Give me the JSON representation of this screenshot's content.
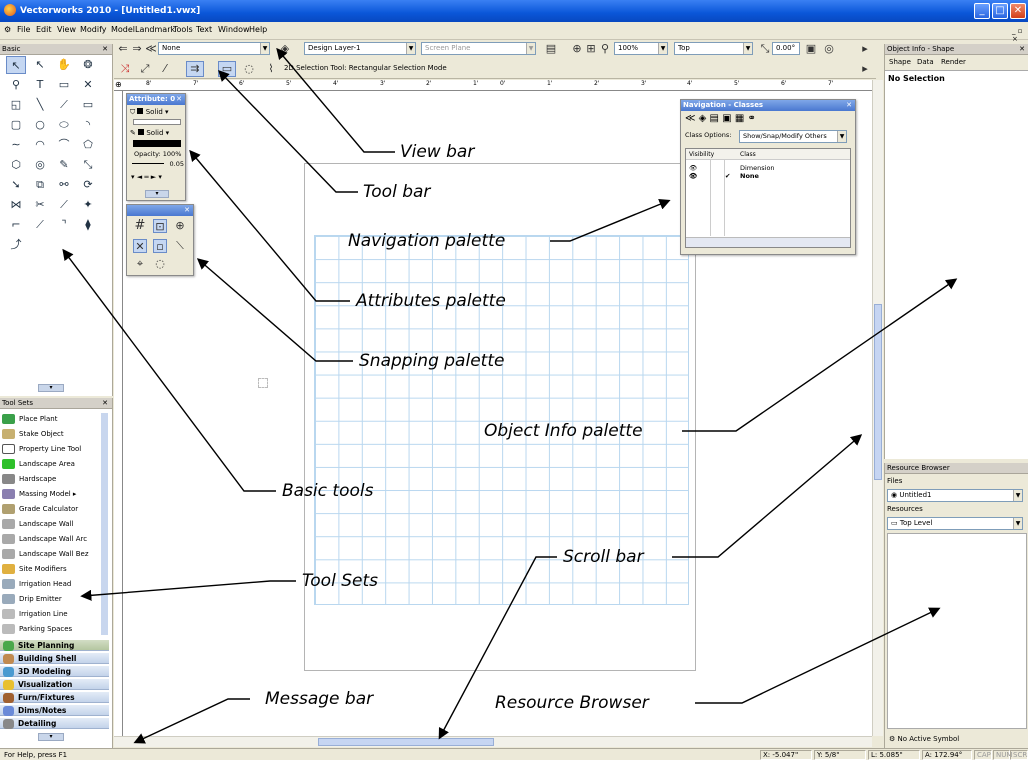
{
  "window": {
    "title": "Vectorworks 2010 - [Untitled1.vwx]",
    "controls": [
      "_",
      "□",
      "✕"
    ]
  },
  "menu": [
    "File",
    "Edit",
    "View",
    "Modify",
    "Model",
    "Landmark",
    "Tools",
    "Text",
    "Window",
    "Help"
  ],
  "view_bar": {
    "class": "None",
    "layer": "Design Layer-1",
    "plane": "Screen Plane",
    "zoom": "100%",
    "view": "Top",
    "rotation": "0.00°"
  },
  "tool_bar": {
    "mode_text": "2D Selection Tool: Rectangular Selection Mode"
  },
  "basic_palette": {
    "title": "Basic"
  },
  "tool_sets": {
    "title": "Tool Sets",
    "items": [
      "Place Plant",
      "Stake Object",
      "Property Line Tool",
      "Landscape Area",
      "Hardscape",
      "Massing Model",
      "Grade Calculator",
      "Landscape Wall",
      "Landscape Wall Arc",
      "Landscape Wall Bez",
      "Site Modifiers",
      "Irrigation Head",
      "Drip Emitter",
      "Irrigation Line",
      "Parking Spaces"
    ],
    "categories": [
      "Site Planning",
      "Building Shell",
      "3D Modeling",
      "Visualization",
      "Furn/Fixtures",
      "Dims/Notes",
      "Detailing"
    ]
  },
  "attributes_palette": {
    "title": "Attribute: 0",
    "fill": "Solid",
    "pen": "Solid",
    "opacity": "Opacity: 100%",
    "line_weight": "0.05"
  },
  "navigation_palette": {
    "title": "Navigation - Classes",
    "class_options_label": "Class Options:",
    "class_options_value": "Show/Snap/Modify Others",
    "col_visibility": "Visibility",
    "col_class": "Class",
    "classes": [
      "Dimension",
      "None"
    ]
  },
  "object_info": {
    "title": "Object Info - Shape",
    "tabs": [
      "Shape",
      "Data",
      "Render"
    ],
    "status": "No Selection"
  },
  "resource_browser": {
    "title": "Resource Browser",
    "files_label": "Files",
    "file": "Untitled1",
    "resources_label": "Resources",
    "level": "Top Level",
    "footer": "No Active Symbol"
  },
  "ruler": [
    "8'",
    "7'",
    "6'",
    "5'",
    "4'",
    "3'",
    "2'",
    "1'",
    "0'",
    "1'",
    "2'",
    "3'",
    "4'",
    "5'",
    "6'",
    "7'"
  ],
  "status_bar": {
    "help": "For Help, press F1",
    "x": "X: -5.047\"",
    "y": "Y: 5/8\"",
    "l": "L: 5.085\"",
    "a": "A: 172.94°",
    "cap": "CAP",
    "num": "NUM",
    "scrl": "SCRL"
  },
  "annotations": {
    "view_bar": "View bar",
    "tool_bar": "Tool bar",
    "navigation": "Navigation palette",
    "attributes": "Attributes palette",
    "snapping": "Snapping palette",
    "object_info": "Object Info palette",
    "basic_tools": "Basic tools",
    "scroll_bar": "Scroll bar",
    "tool_sets": "Tool Sets",
    "message_bar": "Message bar",
    "resource_browser": "Resource Browser"
  },
  "colors": {
    "title_bar": "#0a56d8",
    "grid": "#b9d7ef",
    "category_bg": "#c3d3ea"
  }
}
